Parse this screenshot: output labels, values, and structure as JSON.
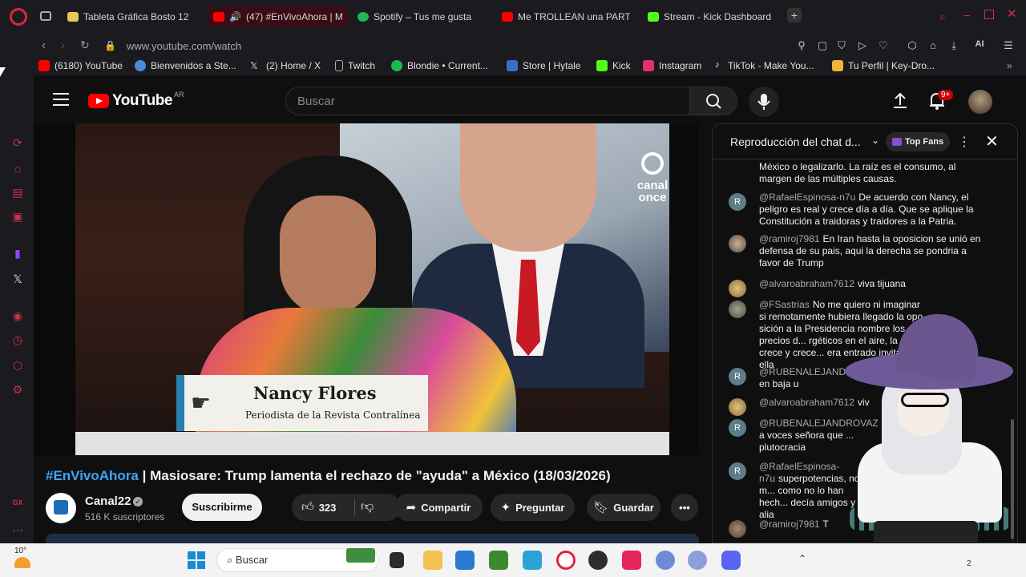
{
  "browser": {
    "tabs": [
      {
        "label": "Tableta Gráfica Bosto 12",
        "active": false,
        "favicon_color": "#e8c65a"
      },
      {
        "label": "(47) #EnVivoAhora | M",
        "active": true,
        "favicon_color": "#ff0000"
      },
      {
        "label": "Spotify – Tus me gusta",
        "active": false,
        "favicon_color": "#1db954"
      },
      {
        "label": "Me TROLLEAN una PARTI",
        "active": false,
        "favicon_color": "#ff0000"
      },
      {
        "label": "Stream - Kick Dashboard",
        "active": false,
        "favicon_color": "#53fc18"
      }
    ],
    "new_tab_icon": "plus-icon",
    "url": "www.youtube.com/watch",
    "ai_label": "AI",
    "bookmarks": [
      {
        "label": "(6180) YouTube",
        "icon": "youtube-icon",
        "color": "#ff0000"
      },
      {
        "label": "Bienvenidos a Ste...",
        "icon": "steam-icon",
        "color": "#4a8bd6"
      },
      {
        "label": "(2) Home / X",
        "icon": "x-icon",
        "color": "#e0e0e0"
      },
      {
        "label": "Twitch",
        "icon": "page-icon",
        "color": "#aaaaaa"
      },
      {
        "label": "Blondie • Current...",
        "icon": "spotify-icon",
        "color": "#1db954"
      },
      {
        "label": "Store | Hytale",
        "icon": "hytale-icon",
        "color": "#3a6fc8"
      },
      {
        "label": "Kick",
        "icon": "kick-icon",
        "color": "#53fc18"
      },
      {
        "label": "Instagram",
        "icon": "instagram-icon",
        "color": "#e1306c"
      },
      {
        "label": "TikTok - Make You...",
        "icon": "tiktok-icon",
        "color": "#ffffff"
      },
      {
        "label": "Tu Perfil | Key-Dro...",
        "icon": "keydrop-icon",
        "color": "#f0b43a"
      }
    ]
  },
  "youtube": {
    "logo_text": "YouTube",
    "country_code": "AR",
    "search_placeholder": "Buscar",
    "notifications_badge": "9+",
    "video": {
      "watermark": "canal once",
      "lower_third_name": "Nancy Flores",
      "lower_third_role": "Periodista de la Revista Contralínea"
    },
    "title_hashtag": "#EnVivoAhora",
    "title_rest": " | Masiosare: Trump lamenta el rechazo de \"ayuda\" a México (18/03/2026)",
    "channel": {
      "name": "Canal22",
      "subscribers": "516 K suscriptores"
    },
    "actions": {
      "subscribe": "Suscribirme",
      "likes": "323",
      "share": "Compartir",
      "ask": "Preguntar",
      "save": "Guardar"
    }
  },
  "chat": {
    "title": "Reproducción del chat d...",
    "top_fans": "Top Fans",
    "messages": [
      {
        "author": "",
        "text": "México o legalizarlo. La raíz es el consumo, al margen de las múltiples causas.",
        "avatar": "none"
      },
      {
        "author": "@RafaelEspinosa-n7u",
        "text": "De acuerdo con Nancy, el peligro es real y crece día a día. Que se aplique la Constitución a traidoras y traidores a la Patria.",
        "avatar": "R"
      },
      {
        "author": "@ramiroj7981",
        "text": "En Iran hasta la oposicion se unió en defensa de su pais, aqui la derecha se pondria a favor de Trump",
        "avatar": "photo"
      },
      {
        "author": "@alvaroabraham7612",
        "text": "viva tijuana",
        "avatar": "photo"
      },
      {
        "author": "@FSastrias",
        "text": "No me quiero ni imaginar si remotamente hubiera llegado la opo­sición a la Presidencia nombre los precios d... rgéticos en el aire, la deuda crece y crece... era entrado invitado x ella",
        "avatar": "photo"
      },
      {
        "author": "@RUBENALEJAND",
        "text": "corrupción en baja u",
        "avatar": "R"
      },
      {
        "author": "@alvaroabraham7612",
        "text": "viv",
        "avatar": "photo"
      },
      {
        "author": "@RUBENALEJANDROVAZ",
        "text": "secreto a voces señora que ... plutocracia",
        "avatar": "R"
      },
      {
        "author": "@RafaelEspinosa-n7u",
        "text": "superpotencias, no m... como no lo han hech... decía amigos y alia",
        "avatar": "R"
      },
      {
        "author": "@ramiroj7981",
        "text": "T",
        "avatar": "photo"
      }
    ]
  },
  "taskbar": {
    "temperature": "10°",
    "search_label": "Buscar",
    "apps": [
      {
        "name": "file-explorer-icon",
        "color": "#f2c14e"
      },
      {
        "name": "store-icon",
        "color": "#2b78d0"
      },
      {
        "name": "minecraft-icon",
        "color": "#3c8a2e"
      },
      {
        "name": "photos-icon",
        "color": "#2aa4d8"
      },
      {
        "name": "opera-icon",
        "color": "#e0243c"
      },
      {
        "name": "obs-icon",
        "color": "#2d2d2d"
      },
      {
        "name": "tiktok-icon",
        "color": "#111111"
      },
      {
        "name": "globe-icon",
        "color": "#6c8cd8"
      },
      {
        "name": "globe-icon-2",
        "color": "#8aa0d8"
      },
      {
        "name": "discord-icon",
        "color": "#5865f2"
      }
    ]
  }
}
